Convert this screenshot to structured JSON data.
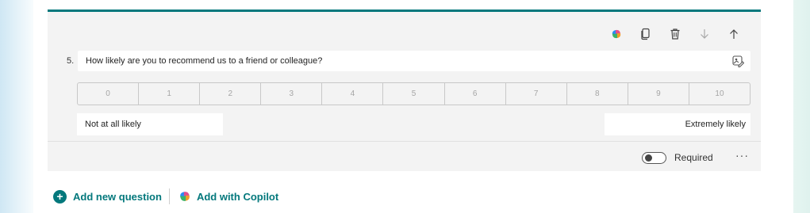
{
  "question": {
    "number": "5.",
    "title": "How likely are you to recommend us to a friend or colleague?",
    "scale": [
      "0",
      "1",
      "2",
      "3",
      "4",
      "5",
      "6",
      "7",
      "8",
      "9",
      "10"
    ],
    "low_label": "Not at all likely",
    "high_label": "Extremely likely"
  },
  "toolbar": {
    "icons": [
      "copilot-icon",
      "copy-icon",
      "delete-icon",
      "move-down-icon",
      "move-up-icon"
    ]
  },
  "footer": {
    "required_label": "Required",
    "required_on": false,
    "more_label": "···"
  },
  "actions": {
    "add_new": "Add new question",
    "add_copilot": "Add with Copilot"
  },
  "colors": {
    "accent": "#03787c",
    "card_bg": "#f3f3f3"
  }
}
